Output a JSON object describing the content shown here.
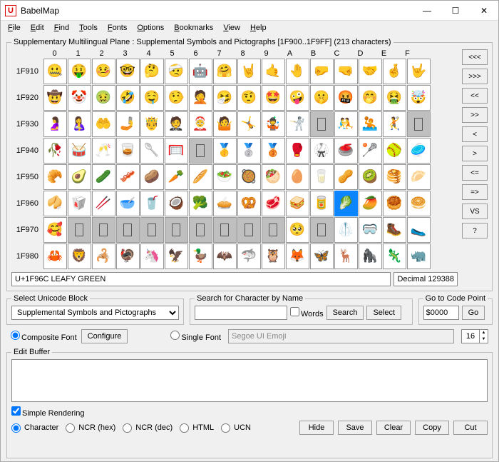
{
  "title": "BabelMap",
  "menu": [
    "File",
    "Edit",
    "Find",
    "Tools",
    "Fonts",
    "Options",
    "Bookmarks",
    "View",
    "Help"
  ],
  "grid_fs_title": "Supplementary Multilingual Plane : Supplemental Symbols and Pictographs [1F900..1F9FF] (213 characters)",
  "cols": [
    "0",
    "1",
    "2",
    "3",
    "4",
    "5",
    "6",
    "7",
    "8",
    "9",
    "A",
    "B",
    "C",
    "D",
    "E",
    "F"
  ],
  "rows": [
    "1F910",
    "1F920",
    "1F930",
    "1F940",
    "1F950",
    "1F960",
    "1F970",
    "1F980"
  ],
  "chars": [
    [
      "🤐",
      "🤑",
      "🤒",
      "🤓",
      "🤔",
      "🤕",
      "🤖",
      "🤗",
      "🤘",
      "🤙",
      "🤚",
      "🤛",
      "🤜",
      "🤝",
      "🤞",
      "🤟"
    ],
    [
      "🤠",
      "🤡",
      "🤢",
      "🤣",
      "🤤",
      "🤥",
      "🤦",
      "🤧",
      "🤨",
      "🤩",
      "🤪",
      "🤫",
      "🤬",
      "🤭",
      "🤮",
      "🤯"
    ],
    [
      "🤰",
      "🤱",
      "🤲",
      "🤳",
      "🤴",
      "🤵",
      "🤶",
      "🤷",
      "🤸",
      "🤹",
      "🤺",
      "",
      "🤼",
      "🤽",
      "🤾",
      ""
    ],
    [
      "🥀",
      "🥁",
      "🥂",
      "🥃",
      "🥄",
      "🥅",
      "",
      "🥇",
      "🥈",
      "🥉",
      "🥊",
      "🥋",
      "🥌",
      "🥍",
      "🥎",
      "🥏"
    ],
    [
      "🥐",
      "🥑",
      "🥒",
      "🥓",
      "🥔",
      "🥕",
      "🥖",
      "🥗",
      "🥘",
      "🥙",
      "🥚",
      "🥛",
      "🥜",
      "🥝",
      "🥞",
      "🥟"
    ],
    [
      "🥠",
      "🥡",
      "🥢",
      "🥣",
      "🥤",
      "🥥",
      "🥦",
      "🥧",
      "🥨",
      "🥩",
      "🥪",
      "🥫",
      "🥬",
      "🥭",
      "🥮",
      "🥯"
    ],
    [
      "🥰",
      "",
      "",
      "",
      "",
      "",
      "",
      "",
      "",
      "",
      "🥺",
      "",
      "🥼",
      "🥽",
      "🥾",
      "🥿"
    ],
    [
      "🦀",
      "🦁",
      "🦂",
      "🦃",
      "🦄",
      "🦅",
      "🦆",
      "🦇",
      "🦈",
      "🦉",
      "🦊",
      "🦋",
      "🦌",
      "🦍",
      "🦎",
      "🦏"
    ]
  ],
  "selected": {
    "row": 5,
    "col": 12
  },
  "info_main": "U+1F96C LEAFY GREEN",
  "info_dec_label": "Decimal",
  "info_dec_value": "129388",
  "side_buttons": [
    "<<<",
    ">>>",
    "<<",
    ">>",
    "<",
    ">",
    "<=",
    "=>",
    "VS",
    "?"
  ],
  "block": {
    "label": "Select Unicode Block",
    "value": "Supplemental Symbols and Pictographs"
  },
  "search": {
    "label": "Search for Character by Name",
    "value": "",
    "words": "Words",
    "search_btn": "Search",
    "select_btn": "Select"
  },
  "goto": {
    "label": "Go to Code Point",
    "value": "$0000",
    "go": "Go"
  },
  "font_row": {
    "composite": "Composite Font",
    "configure": "Configure",
    "single": "Single Font",
    "font_name": "Segoe UI Emoji",
    "size": "16"
  },
  "edit_label": "Edit Buffer",
  "simple_rendering": "Simple Rendering",
  "formats": [
    "Character",
    "NCR (hex)",
    "NCR (dec)",
    "HTML",
    "UCN"
  ],
  "action_buttons": [
    "Hide",
    "Save",
    "Clear",
    "Copy",
    "Cut"
  ],
  "win_icon": "U"
}
